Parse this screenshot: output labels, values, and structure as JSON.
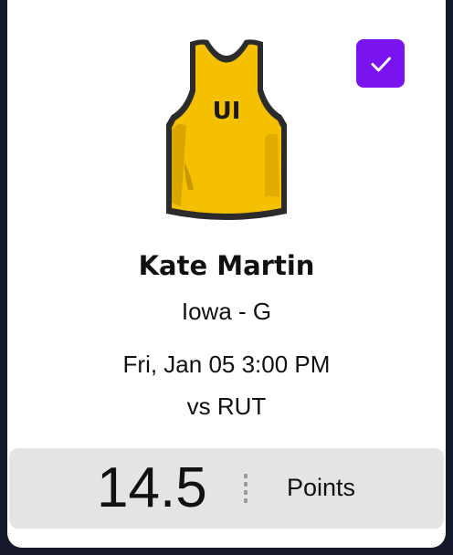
{
  "player": {
    "name": "Kate Martin",
    "team_position": "Iowa - G",
    "jersey_text": "UI",
    "jersey_color": "#f5c000"
  },
  "game": {
    "datetime": "Fri, Jan 05 3:00 PM",
    "opponent": "vs RUT"
  },
  "stat": {
    "value": "14.5",
    "label": "Points"
  },
  "selection": {
    "selected": true,
    "icon": "checkmark-icon",
    "accent_color": "#7b12f0"
  }
}
